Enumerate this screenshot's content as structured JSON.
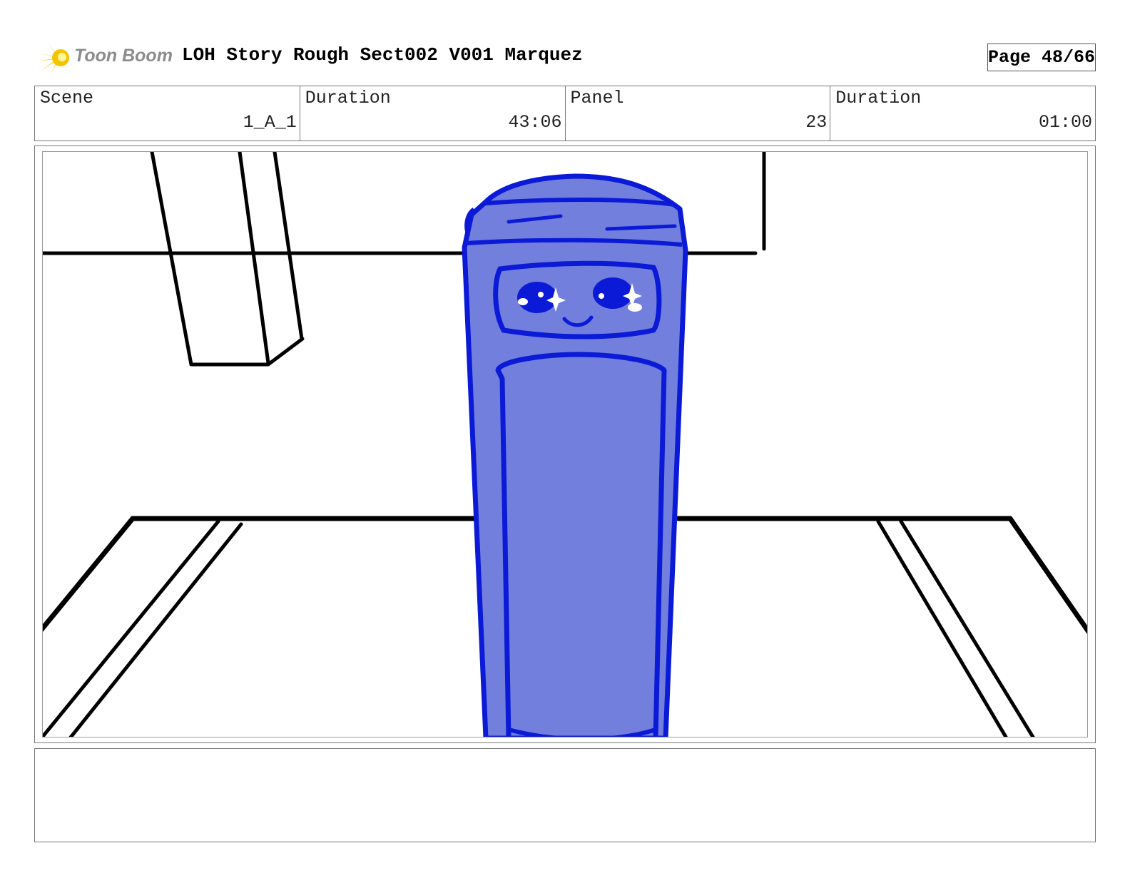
{
  "header": {
    "logo_text": "Toon Boom",
    "title": "LOH Story Rough Sect002 V001 Marquez",
    "page_label": "Page 48/66"
  },
  "info": {
    "scene_label": "Scene",
    "scene_value": "1_A_1",
    "scene_duration_label": "Duration",
    "scene_duration_value": "43:06",
    "panel_label": "Panel",
    "panel_value": "23",
    "panel_duration_label": "Duration",
    "panel_duration_value": "01:00"
  },
  "colors": {
    "character_fill": "#737fdd",
    "character_line": "#0a1ad6",
    "logo_yellow": "#f5c400",
    "logo_text": "#8c8c8c"
  },
  "notes": ""
}
